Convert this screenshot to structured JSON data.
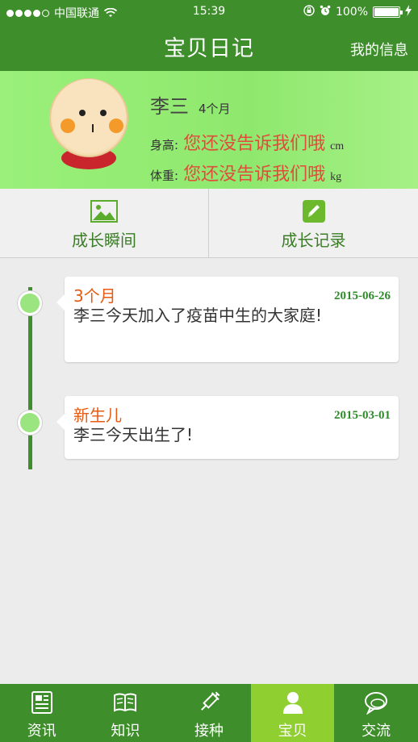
{
  "status": {
    "carrier": "中国联通",
    "time": "15:39",
    "battery_text": "100%",
    "battery_level": 1.0
  },
  "header": {
    "title": "宝贝日记",
    "right_link": "我的信息"
  },
  "profile": {
    "name": "李三",
    "age": "4个月",
    "height_label": "身高:",
    "height_value": "您还没告诉我们哦",
    "height_unit": "cm",
    "weight_label": "体重:",
    "weight_value": "您还没告诉我们哦",
    "weight_unit": "kg"
  },
  "tabs": [
    {
      "label": "成长瞬间",
      "icon": "image-icon"
    },
    {
      "label": "成长记录",
      "icon": "pencil-icon"
    }
  ],
  "timeline": [
    {
      "title": "3个月",
      "date": "2015-06-26",
      "text": "李三今天加入了疫苗中生的大家庭!"
    },
    {
      "title": "新生儿",
      "date": "2015-03-01",
      "text": "李三今天出生了!"
    }
  ],
  "bottom_nav": [
    {
      "label": "资讯",
      "icon": "newspaper-icon"
    },
    {
      "label": "知识",
      "icon": "book-icon"
    },
    {
      "label": "接种",
      "icon": "syringe-icon"
    },
    {
      "label": "宝贝",
      "icon": "baby-icon",
      "active": true
    },
    {
      "label": "交流",
      "icon": "chat-icon"
    }
  ],
  "colors": {
    "header_green": "#3f8e2c",
    "profile_green": "#9af07a",
    "active_tab": "#8fcf2f",
    "accent_red": "#e24a3b",
    "accent_orange": "#e65a12"
  }
}
